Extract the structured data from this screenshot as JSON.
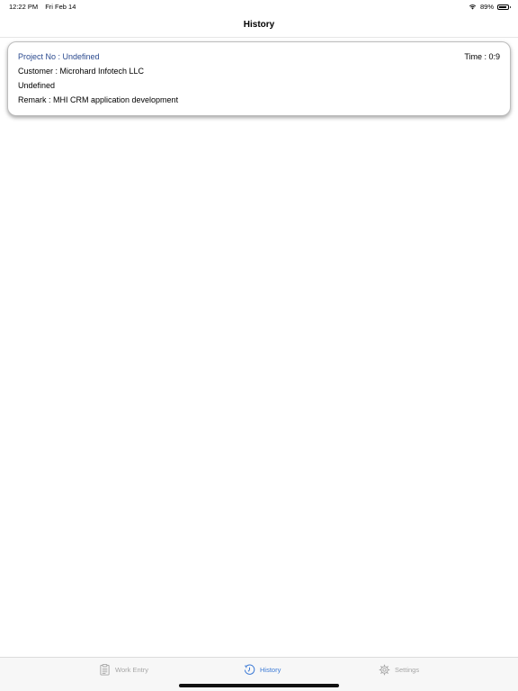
{
  "status_bar": {
    "time": "12:22 PM",
    "date": "Fri Feb 14",
    "battery": "89%",
    "battery_level": 0.89,
    "wifi_icon": "wifi-icon"
  },
  "nav": {
    "title": "History"
  },
  "history": {
    "entries": [
      {
        "project_no": "Project No : Undefined",
        "time": "Time : 0:9",
        "customer": "Customer : Microhard Infotech LLC",
        "status": "Undefined",
        "remark": "Remark : MHI CRM application development"
      }
    ]
  },
  "tab_bar": {
    "tabs": [
      {
        "label": "Work Entry",
        "icon": "clipboard-icon",
        "active": false
      },
      {
        "label": "History",
        "icon": "clock-history-icon",
        "active": true
      },
      {
        "label": "Settings",
        "icon": "gear-icon",
        "active": false
      }
    ],
    "active_color": "#3d7bd6",
    "inactive_color": "#a6a6a6"
  }
}
